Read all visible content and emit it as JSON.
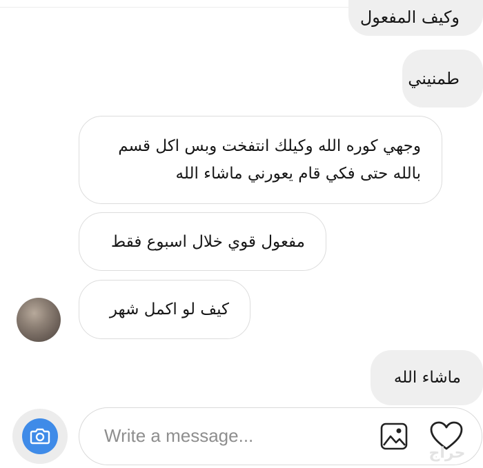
{
  "messages": [
    {
      "side": "sent",
      "text": "وكيف المفعول"
    },
    {
      "side": "sent",
      "text": "طمنيني"
    },
    {
      "side": "received",
      "text": "وجهي كوره الله وكيلك انتفخت وبس اكل قسم\nبالله حتى فكي قام يعورني ماشاء الله"
    },
    {
      "side": "received",
      "text": "مفعول قوي خلال اسبوع فقط"
    },
    {
      "side": "received",
      "text": "كيف لو اكمل شهر"
    },
    {
      "side": "sent",
      "text": "ماشاء الله"
    }
  ],
  "composer": {
    "placeholder": "Write a message..."
  },
  "icons": {
    "camera": "camera-icon",
    "gallery": "image-icon",
    "like": "heart-icon"
  },
  "colors": {
    "sent_bubble": "#efefef",
    "received_border": "#dcdcdc",
    "camera_blue": "#3f8be8"
  },
  "watermark": "حراج"
}
